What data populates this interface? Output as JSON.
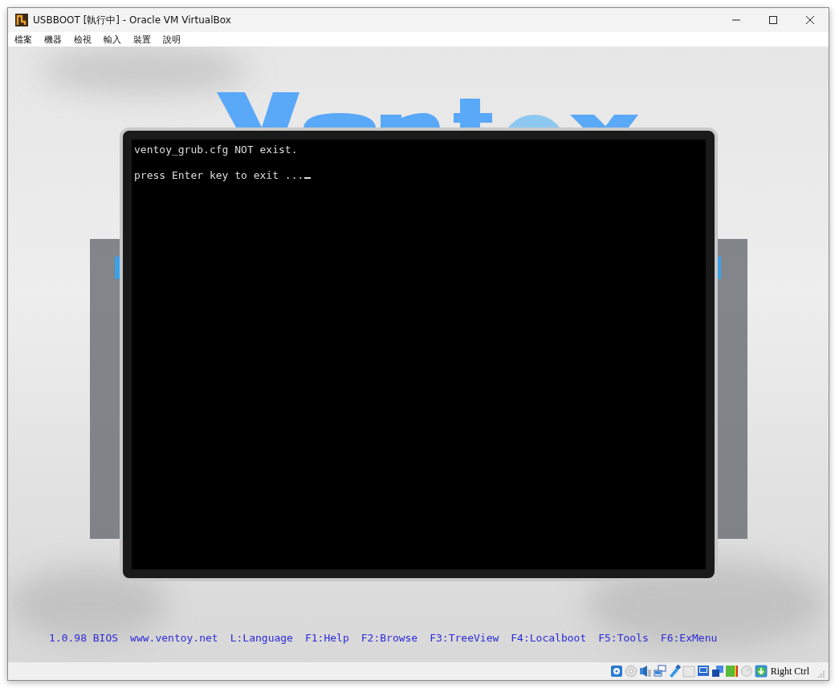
{
  "window": {
    "title": "USBBOOT [執行中] - Oracle VM VirtualBox"
  },
  "menu": [
    "檔案",
    "機器",
    "檢視",
    "輸入",
    "裝置",
    "說明"
  ],
  "vm_screen": {
    "console_lines": [
      "ventoy_grub.cfg NOT exist.",
      "press Enter key to exit ..."
    ],
    "footer": [
      "1.0.98 BIOS",
      "www.ventoy.net",
      "L:Language",
      "F1:Help",
      "F2:Browse",
      "F3:TreeView",
      "F4:Localboot",
      "F5:Tools",
      "F6:ExMenu"
    ]
  },
  "status_bar": {
    "host_key": "Right Ctrl"
  }
}
